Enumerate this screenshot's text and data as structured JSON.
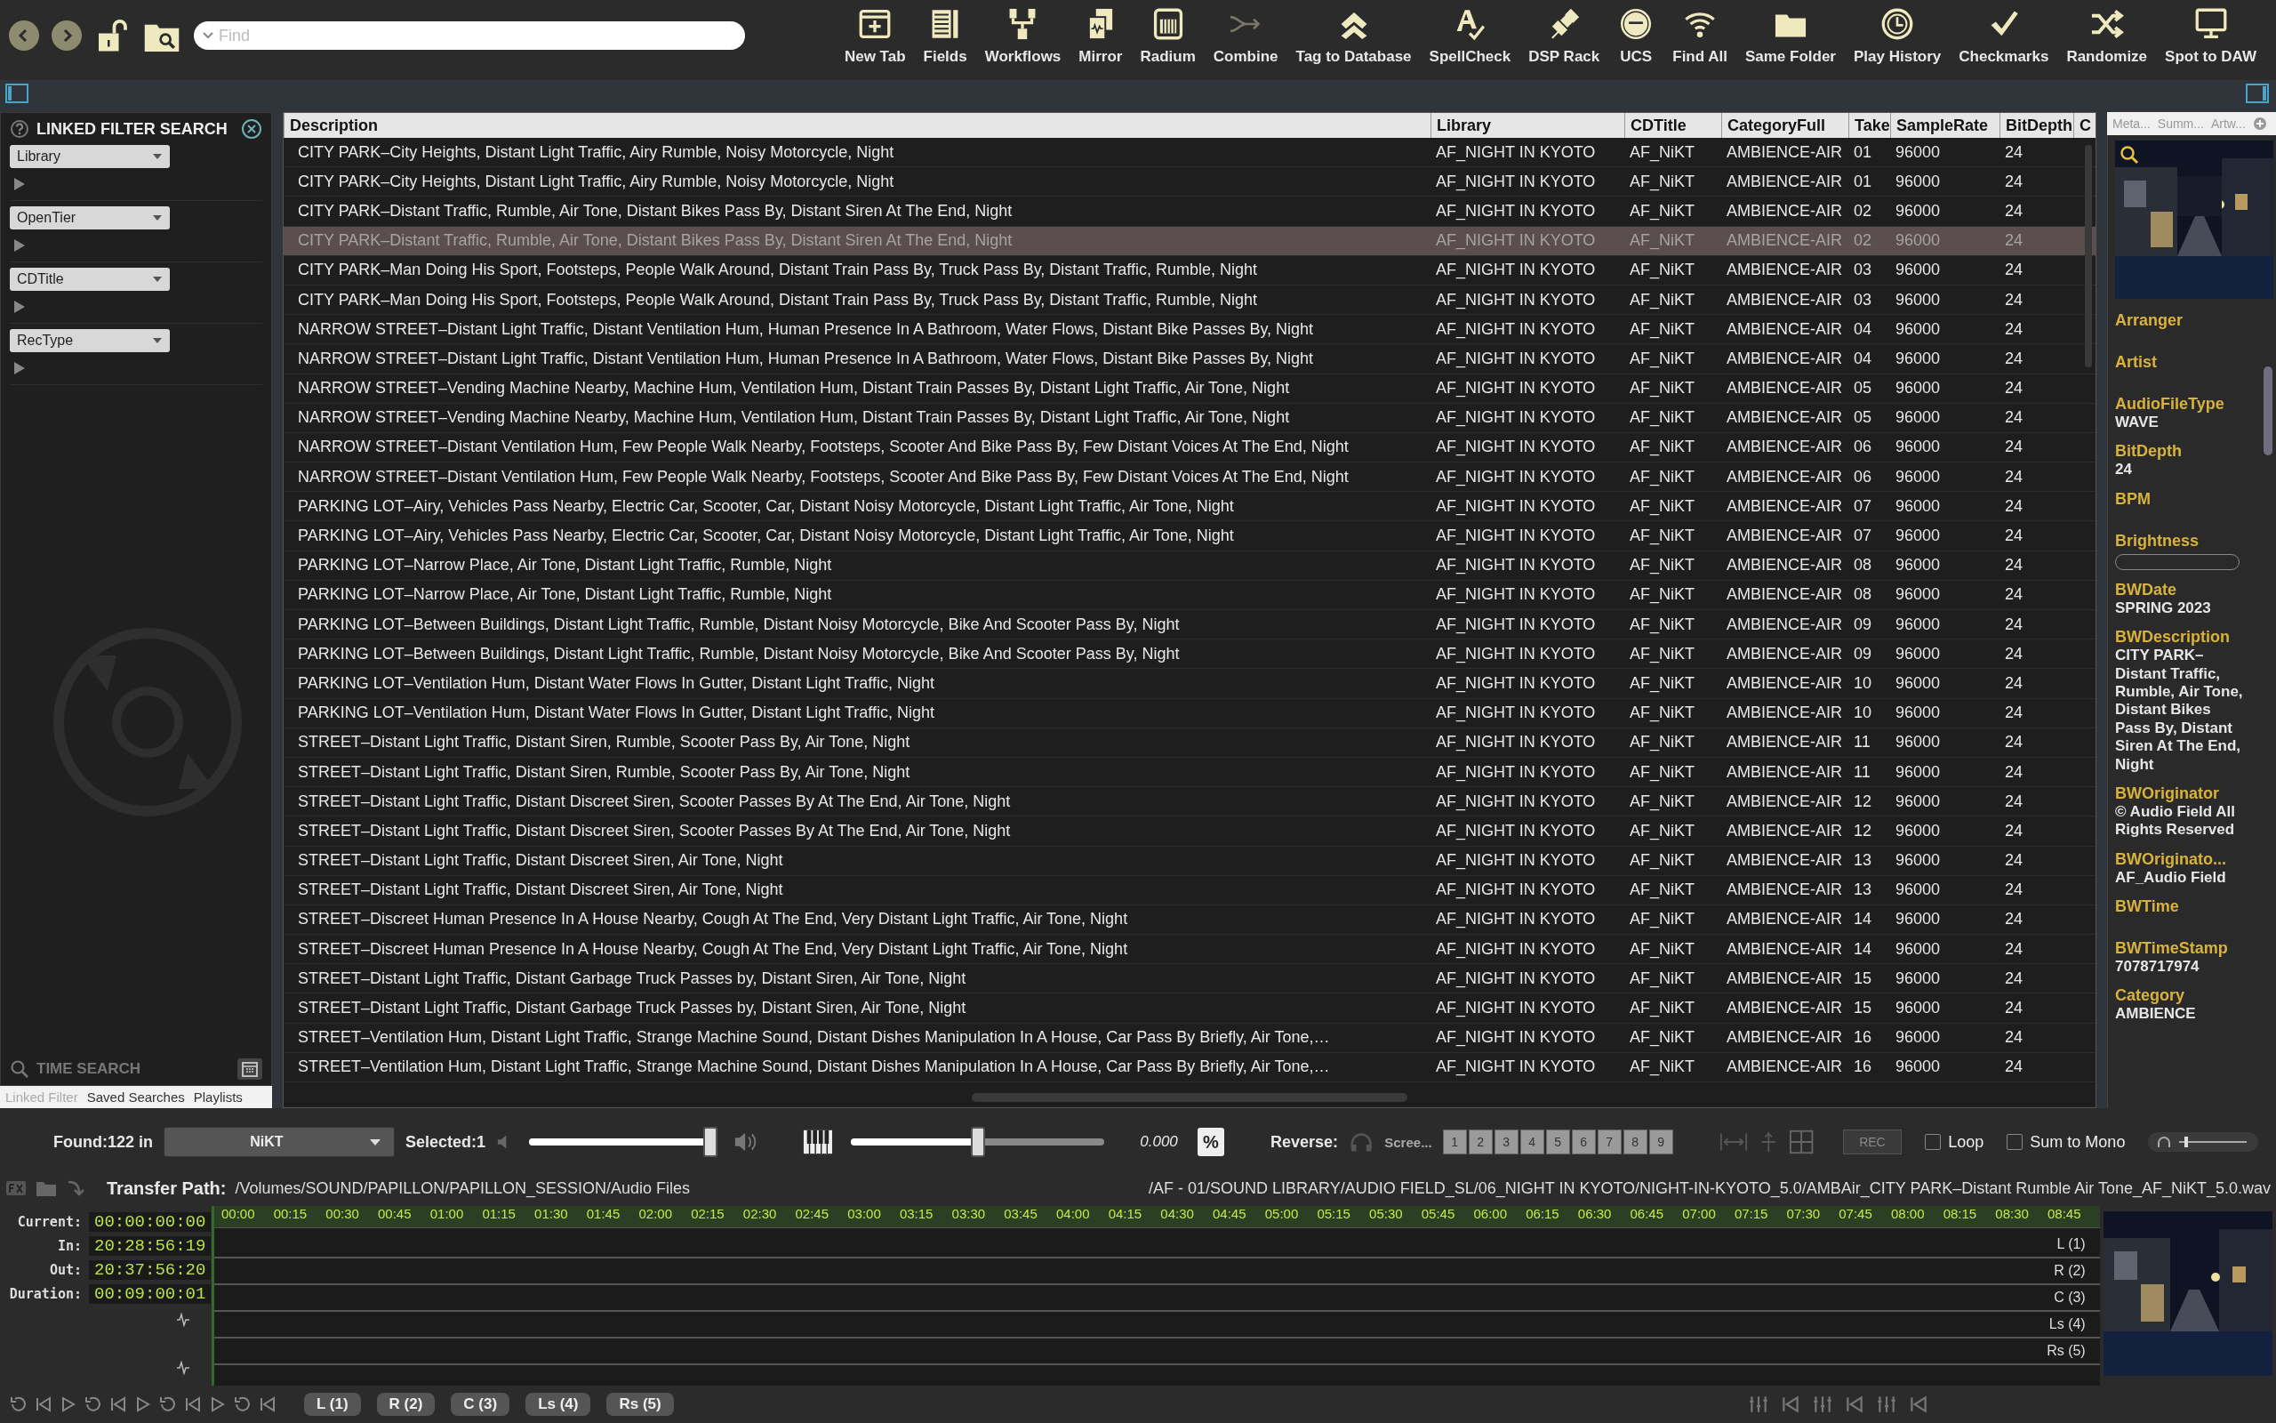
{
  "toolbar": {
    "search": {
      "placeholder": "Find"
    },
    "tools": [
      {
        "label": "New Tab",
        "disabled": false
      },
      {
        "label": "Fields",
        "disabled": false
      },
      {
        "label": "Workflows",
        "disabled": false
      },
      {
        "label": "Mirror",
        "disabled": false
      },
      {
        "label": "Radium",
        "disabled": false
      },
      {
        "label": "Combine",
        "disabled": true
      },
      {
        "label": "Tag to Database",
        "disabled": false
      },
      {
        "label": "SpellCheck",
        "disabled": false
      },
      {
        "label": "DSP Rack",
        "disabled": false
      },
      {
        "label": "UCS",
        "disabled": false
      },
      {
        "label": "Find All",
        "disabled": false
      },
      {
        "label": "Same Folder",
        "disabled": false
      },
      {
        "label": "Play History",
        "disabled": false
      },
      {
        "label": "Checkmarks",
        "disabled": false
      },
      {
        "label": "Randomize",
        "disabled": false
      },
      {
        "label": "Spot to DAW",
        "disabled": false
      }
    ]
  },
  "filter_panel": {
    "title": "LINKED FILTER SEARCH",
    "filters": [
      "Library",
      "OpenTier",
      "CDTitle",
      "RecType"
    ],
    "time_search": "TIME SEARCH",
    "tabs": [
      {
        "label": "Linked Filter",
        "selected": true
      },
      {
        "label": "Saved Searches",
        "selected": false
      },
      {
        "label": "Playlists",
        "selected": false
      }
    ]
  },
  "table": {
    "columns": [
      "Description",
      "Library",
      "CDTitle",
      "CategoryFull",
      "Take",
      "SampleRate",
      "BitDepth",
      "C"
    ],
    "rows": [
      {
        "description": "CITY PARK–City Heights, Distant Light Traffic, Airy Rumble, Noisy Motorcycle, Night",
        "library": "AF_NIGHT IN KYOTO",
        "cdtitle": "AF_NiKT",
        "category": "AMBIENCE-AIR",
        "take": "01",
        "samplerate": "96000",
        "bitdepth": "24",
        "selected": false
      },
      {
        "description": "CITY PARK–City Heights, Distant Light Traffic, Airy Rumble, Noisy Motorcycle, Night",
        "library": "AF_NIGHT IN KYOTO",
        "cdtitle": "AF_NiKT",
        "category": "AMBIENCE-AIR",
        "take": "01",
        "samplerate": "96000",
        "bitdepth": "24",
        "selected": false
      },
      {
        "description": "CITY PARK–Distant Traffic, Rumble, Air Tone, Distant Bikes Pass By, Distant Siren At The End, Night",
        "library": "AF_NIGHT IN KYOTO",
        "cdtitle": "AF_NiKT",
        "category": "AMBIENCE-AIR",
        "take": "02",
        "samplerate": "96000",
        "bitdepth": "24",
        "selected": false
      },
      {
        "description": "CITY PARK–Distant Traffic, Rumble, Air Tone, Distant Bikes Pass By, Distant Siren At The End, Night",
        "library": "AF_NIGHT IN KYOTO",
        "cdtitle": "AF_NiKT",
        "category": "AMBIENCE-AIR",
        "take": "02",
        "samplerate": "96000",
        "bitdepth": "24",
        "selected": true
      },
      {
        "description": "CITY PARK–Man Doing His Sport, Footsteps, People Walk Around, Distant Train Pass By, Truck Pass By, Distant Traffic, Rumble, Night",
        "library": "AF_NIGHT IN KYOTO",
        "cdtitle": "AF_NiKT",
        "category": "AMBIENCE-AIR",
        "take": "03",
        "samplerate": "96000",
        "bitdepth": "24",
        "selected": false
      },
      {
        "description": "CITY PARK–Man Doing His Sport, Footsteps, People Walk Around, Distant Train Pass By, Truck Pass By, Distant Traffic, Rumble, Night",
        "library": "AF_NIGHT IN KYOTO",
        "cdtitle": "AF_NiKT",
        "category": "AMBIENCE-AIR",
        "take": "03",
        "samplerate": "96000",
        "bitdepth": "24",
        "selected": false
      },
      {
        "description": "NARROW STREET–Distant Light Traffic, Distant Ventilation Hum, Human Presence In A Bathroom, Water Flows, Distant Bike Passes By, Night",
        "library": "AF_NIGHT IN KYOTO",
        "cdtitle": "AF_NiKT",
        "category": "AMBIENCE-AIR",
        "take": "04",
        "samplerate": "96000",
        "bitdepth": "24",
        "selected": false
      },
      {
        "description": "NARROW STREET–Distant Light Traffic, Distant Ventilation Hum, Human Presence In A Bathroom, Water Flows, Distant Bike Passes By, Night",
        "library": "AF_NIGHT IN KYOTO",
        "cdtitle": "AF_NiKT",
        "category": "AMBIENCE-AIR",
        "take": "04",
        "samplerate": "96000",
        "bitdepth": "24",
        "selected": false
      },
      {
        "description": "NARROW STREET–Vending Machine Nearby, Machine Hum, Ventilation Hum, Distant Train Passes By, Distant Light Traffic, Air Tone, Night",
        "library": "AF_NIGHT IN KYOTO",
        "cdtitle": "AF_NiKT",
        "category": "AMBIENCE-AIR",
        "take": "05",
        "samplerate": "96000",
        "bitdepth": "24",
        "selected": false
      },
      {
        "description": "NARROW STREET–Vending Machine Nearby, Machine Hum, Ventilation Hum, Distant Train Passes By, Distant Light Traffic, Air Tone, Night",
        "library": "AF_NIGHT IN KYOTO",
        "cdtitle": "AF_NiKT",
        "category": "AMBIENCE-AIR",
        "take": "05",
        "samplerate": "96000",
        "bitdepth": "24",
        "selected": false
      },
      {
        "description": "NARROW STREET–Distant Ventilation Hum, Few People Walk Nearby, Footsteps, Scooter And Bike Pass By, Few Distant Voices At The End, Night",
        "library": "AF_NIGHT IN KYOTO",
        "cdtitle": "AF_NiKT",
        "category": "AMBIENCE-AIR",
        "take": "06",
        "samplerate": "96000",
        "bitdepth": "24",
        "selected": false
      },
      {
        "description": "NARROW STREET–Distant Ventilation Hum, Few People Walk Nearby, Footsteps, Scooter And Bike Pass By, Few Distant Voices At The End, Night",
        "library": "AF_NIGHT IN KYOTO",
        "cdtitle": "AF_NiKT",
        "category": "AMBIENCE-AIR",
        "take": "06",
        "samplerate": "96000",
        "bitdepth": "24",
        "selected": false
      },
      {
        "description": "PARKING LOT–Airy, Vehicles Pass Nearby, Electric Car, Scooter, Car, Distant Noisy Motorcycle, Distant Light Traffic, Air Tone, Night",
        "library": "AF_NIGHT IN KYOTO",
        "cdtitle": "AF_NiKT",
        "category": "AMBIENCE-AIR",
        "take": "07",
        "samplerate": "96000",
        "bitdepth": "24",
        "selected": false
      },
      {
        "description": "PARKING LOT–Airy, Vehicles Pass Nearby, Electric Car, Scooter, Car, Distant Noisy Motorcycle, Distant Light Traffic, Air Tone, Night",
        "library": "AF_NIGHT IN KYOTO",
        "cdtitle": "AF_NiKT",
        "category": "AMBIENCE-AIR",
        "take": "07",
        "samplerate": "96000",
        "bitdepth": "24",
        "selected": false
      },
      {
        "description": "PARKING LOT–Narrow Place, Air Tone, Distant Light Traffic, Rumble, Night",
        "library": "AF_NIGHT IN KYOTO",
        "cdtitle": "AF_NiKT",
        "category": "AMBIENCE-AIR",
        "take": "08",
        "samplerate": "96000",
        "bitdepth": "24",
        "selected": false
      },
      {
        "description": "PARKING LOT–Narrow Place, Air Tone, Distant Light Traffic, Rumble, Night",
        "library": "AF_NIGHT IN KYOTO",
        "cdtitle": "AF_NiKT",
        "category": "AMBIENCE-AIR",
        "take": "08",
        "samplerate": "96000",
        "bitdepth": "24",
        "selected": false
      },
      {
        "description": "PARKING LOT–Between Buildings, Distant Light Traffic, Rumble, Distant Noisy Motorcycle, Bike And Scooter Pass By, Night",
        "library": "AF_NIGHT IN KYOTO",
        "cdtitle": "AF_NiKT",
        "category": "AMBIENCE-AIR",
        "take": "09",
        "samplerate": "96000",
        "bitdepth": "24",
        "selected": false
      },
      {
        "description": "PARKING LOT–Between Buildings, Distant Light Traffic, Rumble, Distant Noisy Motorcycle, Bike And Scooter Pass By, Night",
        "library": "AF_NIGHT IN KYOTO",
        "cdtitle": "AF_NiKT",
        "category": "AMBIENCE-AIR",
        "take": "09",
        "samplerate": "96000",
        "bitdepth": "24",
        "selected": false
      },
      {
        "description": "PARKING LOT–Ventilation Hum, Distant Water Flows In Gutter, Distant Light Traffic, Night",
        "library": "AF_NIGHT IN KYOTO",
        "cdtitle": "AF_NiKT",
        "category": "AMBIENCE-AIR",
        "take": "10",
        "samplerate": "96000",
        "bitdepth": "24",
        "selected": false
      },
      {
        "description": "PARKING LOT–Ventilation Hum, Distant Water Flows In Gutter, Distant Light Traffic, Night",
        "library": "AF_NIGHT IN KYOTO",
        "cdtitle": "AF_NiKT",
        "category": "AMBIENCE-AIR",
        "take": "10",
        "samplerate": "96000",
        "bitdepth": "24",
        "selected": false
      },
      {
        "description": "STREET–Distant Light Traffic, Distant Siren, Rumble, Scooter Pass By, Air Tone, Night",
        "library": "AF_NIGHT IN KYOTO",
        "cdtitle": "AF_NiKT",
        "category": "AMBIENCE-AIR",
        "take": "11",
        "samplerate": "96000",
        "bitdepth": "24",
        "selected": false
      },
      {
        "description": "STREET–Distant Light Traffic, Distant Siren, Rumble, Scooter Pass By, Air Tone, Night",
        "library": "AF_NIGHT IN KYOTO",
        "cdtitle": "AF_NiKT",
        "category": "AMBIENCE-AIR",
        "take": "11",
        "samplerate": "96000",
        "bitdepth": "24",
        "selected": false
      },
      {
        "description": "STREET–Distant Light Traffic, Distant Discreet Siren, Scooter Passes By At The End, Air Tone, Night",
        "library": "AF_NIGHT IN KYOTO",
        "cdtitle": "AF_NiKT",
        "category": "AMBIENCE-AIR",
        "take": "12",
        "samplerate": "96000",
        "bitdepth": "24",
        "selected": false
      },
      {
        "description": "STREET–Distant Light Traffic, Distant Discreet Siren, Scooter Passes By At The End, Air Tone, Night",
        "library": "AF_NIGHT IN KYOTO",
        "cdtitle": "AF_NiKT",
        "category": "AMBIENCE-AIR",
        "take": "12",
        "samplerate": "96000",
        "bitdepth": "24",
        "selected": false
      },
      {
        "description": "STREET–Distant Light Traffic, Distant Discreet Siren, Air Tone, Night",
        "library": "AF_NIGHT IN KYOTO",
        "cdtitle": "AF_NiKT",
        "category": "AMBIENCE-AIR",
        "take": "13",
        "samplerate": "96000",
        "bitdepth": "24",
        "selected": false
      },
      {
        "description": "STREET–Distant Light Traffic, Distant Discreet Siren, Air Tone, Night",
        "library": "AF_NIGHT IN KYOTO",
        "cdtitle": "AF_NiKT",
        "category": "AMBIENCE-AIR",
        "take": "13",
        "samplerate": "96000",
        "bitdepth": "24",
        "selected": false
      },
      {
        "description": "STREET–Discreet Human Presence In A House Nearby, Cough At The End, Very Distant Light Traffic, Air Tone, Night",
        "library": "AF_NIGHT IN KYOTO",
        "cdtitle": "AF_NiKT",
        "category": "AMBIENCE-AIR",
        "take": "14",
        "samplerate": "96000",
        "bitdepth": "24",
        "selected": false
      },
      {
        "description": "STREET–Discreet Human Presence In A House Nearby, Cough At The End, Very Distant Light Traffic, Air Tone, Night",
        "library": "AF_NIGHT IN KYOTO",
        "cdtitle": "AF_NiKT",
        "category": "AMBIENCE-AIR",
        "take": "14",
        "samplerate": "96000",
        "bitdepth": "24",
        "selected": false
      },
      {
        "description": "STREET–Distant Light Traffic, Distant Garbage Truck Passes by, Distant Siren, Air Tone, Night",
        "library": "AF_NIGHT IN KYOTO",
        "cdtitle": "AF_NiKT",
        "category": "AMBIENCE-AIR",
        "take": "15",
        "samplerate": "96000",
        "bitdepth": "24",
        "selected": false
      },
      {
        "description": "STREET–Distant Light Traffic, Distant Garbage Truck Passes by, Distant Siren, Air Tone, Night",
        "library": "AF_NIGHT IN KYOTO",
        "cdtitle": "AF_NiKT",
        "category": "AMBIENCE-AIR",
        "take": "15",
        "samplerate": "96000",
        "bitdepth": "24",
        "selected": false
      },
      {
        "description": "STREET–Ventilation Hum, Distant Light Traffic, Strange Machine Sound, Distant Dishes Manipulation In A House, Car Pass By Briefly, Air Tone,…",
        "library": "AF_NIGHT IN KYOTO",
        "cdtitle": "AF_NiKT",
        "category": "AMBIENCE-AIR",
        "take": "16",
        "samplerate": "96000",
        "bitdepth": "24",
        "selected": false
      },
      {
        "description": "STREET–Ventilation Hum, Distant Light Traffic, Strange Machine Sound, Distant Dishes Manipulation In A House, Car Pass By Briefly, Air Tone,…",
        "library": "AF_NIGHT IN KYOTO",
        "cdtitle": "AF_NiKT",
        "category": "AMBIENCE-AIR",
        "take": "16",
        "samplerate": "96000",
        "bitdepth": "24",
        "selected": false
      }
    ]
  },
  "inspector": {
    "tabs": [
      "Meta...",
      "Summ...",
      "Artw..."
    ],
    "fields": [
      {
        "kind": "text",
        "label": "Arranger"
      },
      {
        "kind": "text",
        "label": "Artist"
      },
      {
        "kind": "text",
        "label": "AudioFileType",
        "value": "WAVE"
      },
      {
        "kind": "text",
        "label": "BitDepth",
        "value": "24"
      },
      {
        "kind": "text",
        "label": "BPM"
      },
      {
        "kind": "field",
        "label": "Brightness"
      },
      {
        "kind": "text",
        "label": "BWDate",
        "value": "SPRING 2023"
      },
      {
        "kind": "text",
        "label": "BWDescription",
        "value": "CITY PARK–Distant Traffic, Rumble, Air Tone, Distant Bikes Pass By, Distant Siren At The End, Night"
      },
      {
        "kind": "text",
        "label": "BWOriginator",
        "value": "© Audio Field All Rights Reserved"
      },
      {
        "kind": "text",
        "label": "BWOriginato...",
        "value": "AF_Audio Field"
      },
      {
        "kind": "text",
        "label": "BWTime"
      },
      {
        "kind": "text",
        "label": "BWTimeStamp",
        "value": "7078717974"
      },
      {
        "kind": "text",
        "label": "Category",
        "value": "AMBIENCE"
      }
    ]
  },
  "controls": {
    "found": "Found:122 in",
    "library": "NiKT",
    "selected": "Selected:1",
    "volume": {
      "level": 0.97
    },
    "pitch": {
      "level": 0.5
    },
    "pitch_reading": "0.000",
    "percent": "%",
    "reverse": "Reverse:",
    "screen": "Scree...",
    "markers": [
      "1",
      "2",
      "3",
      "4",
      "5",
      "6",
      "7",
      "8",
      "9"
    ],
    "rec": "REC",
    "loop": {
      "label": "Loop",
      "checked": false
    },
    "sum_to_mono": {
      "label": "Sum to Mono",
      "checked": false
    },
    "monitor": {
      "level": 0.1
    }
  },
  "transfer": {
    "label": "Transfer Path:",
    "path": "/Volumes/SOUND/PAPILLON/PAPILLON_SESSION/Audio Files",
    "file_path": "/AF - 01/SOUND LIBRARY/AUDIO FIELD_SL/06_NIGHT IN KYOTO/NIGHT-IN-KYOTO_5.0/AMBAir_CITY PARK–Distant Rumble Air Tone_AF_NiKT_5.0.wav"
  },
  "timeline": {
    "timecodes": [
      {
        "label": "Current:",
        "value": "00:00:00:00"
      },
      {
        "label": "In:",
        "value": "20:28:56:19"
      },
      {
        "label": "Out:",
        "value": "20:37:56:20"
      },
      {
        "label": "Duration:",
        "value": "00:09:00:01"
      }
    ],
    "ruler": [
      "00:00",
      "00:15",
      "00:30",
      "00:45",
      "01:00",
      "01:15",
      "01:30",
      "01:45",
      "02:00",
      "02:15",
      "02:30",
      "02:45",
      "03:00",
      "03:15",
      "03:30",
      "03:45",
      "04:00",
      "04:15",
      "04:30",
      "04:45",
      "05:00",
      "05:15",
      "05:30",
      "05:45",
      "06:00",
      "06:15",
      "06:30",
      "06:45",
      "07:00",
      "07:15",
      "07:30",
      "07:45",
      "08:00",
      "08:15",
      "08:30",
      "08:45"
    ],
    "channels": [
      "L (1)",
      "R (2)",
      "C (3)",
      "Ls (4)",
      "Rs (5)"
    ]
  },
  "channel_buttons": [
    "L (1)",
    "R (2)",
    "C (3)",
    "Ls (4)",
    "Rs (5)"
  ]
}
